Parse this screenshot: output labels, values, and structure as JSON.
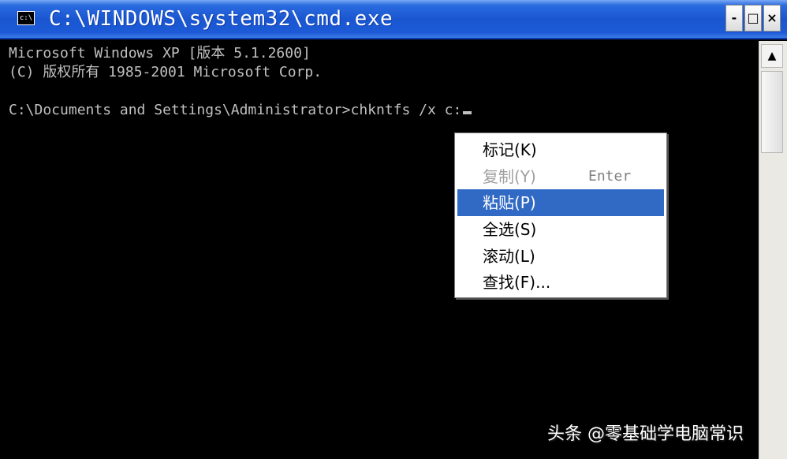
{
  "window": {
    "title": "C:\\WINDOWS\\system32\\cmd.exe",
    "icon_text": "c:\\",
    "icon": "console-app-icon"
  },
  "controls": {
    "minimize": "-",
    "maximize": "□",
    "close": "×"
  },
  "console": {
    "lines": [
      "Microsoft Windows XP [版本 5.1.2600]",
      "(C) 版权所有 1985-2001 Microsoft Corp.",
      "",
      "C:\\Documents and Settings\\Administrator>chkntfs /x c:"
    ]
  },
  "scrollbar": {
    "up_arrow": "▲"
  },
  "context_menu": {
    "items": [
      {
        "label": "标记(K)",
        "shortcut": "",
        "enabled": true,
        "selected": false
      },
      {
        "label": "复制(Y)",
        "shortcut": "Enter",
        "enabled": false,
        "selected": false
      },
      {
        "label": "粘贴(P)",
        "shortcut": "",
        "enabled": true,
        "selected": true
      },
      {
        "label": "全选(S)",
        "shortcut": "",
        "enabled": true,
        "selected": false
      },
      {
        "label": "滚动(L)",
        "shortcut": "",
        "enabled": true,
        "selected": false
      },
      {
        "label": "查找(F)...",
        "shortcut": "",
        "enabled": true,
        "selected": false
      }
    ],
    "selected_color": "#316ac5"
  },
  "watermark": {
    "text": "头条 @零基础学电脑常识"
  }
}
